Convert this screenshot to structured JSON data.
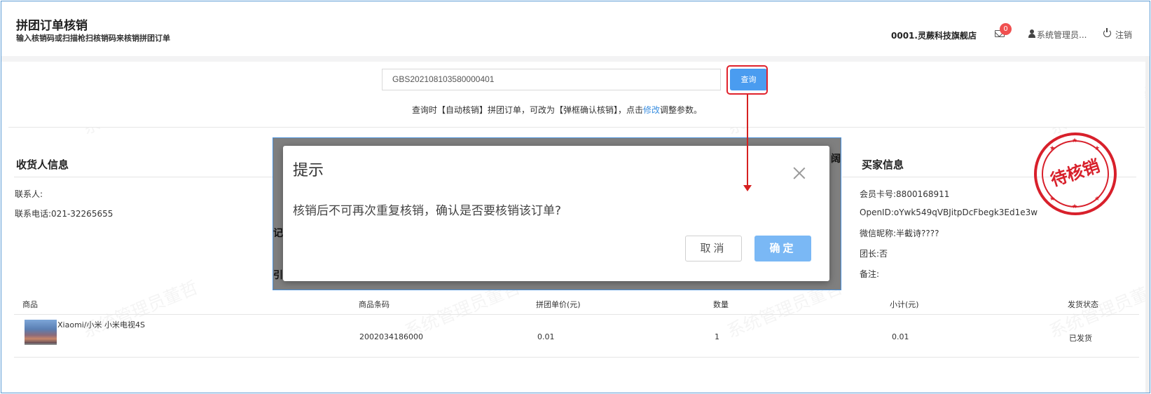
{
  "header": {
    "title": "拼团订单核销",
    "subtitle": "输入核销码或扫描枪扫核销码来核销拼团订单",
    "store": "0001.灵蕨科技旗舰店",
    "mail_count": "0",
    "user": "系统管理员...",
    "logout": "注销"
  },
  "search": {
    "value": "GBS202108103580000401",
    "button": "查询",
    "hint_pre": "查询时【自动核销】拼团订单，可改为【弹框确认核销】，点击",
    "hint_link": "修改",
    "hint_post": "调整参数。"
  },
  "receiver": {
    "title": "收货人信息",
    "contact_label": "联系人:",
    "phone_label": "联系电话:021-32265655"
  },
  "buyer": {
    "title": "买家信息",
    "member_card": "会员卡号:8800168911",
    "openid": "OpenID:oYwk549qVBJitpDcFbegk3Ed1e3w",
    "nickname": "微信昵称:半截诗????",
    "leader": "团长:否",
    "remark": "备注:"
  },
  "stamp": {
    "text": "待核销"
  },
  "table": {
    "headers": [
      "商品",
      "商品条码",
      "拼团单价(元)",
      "数量",
      "小计(元)",
      "发货状态"
    ],
    "rows": [
      {
        "product": "Xiaomi/小米 小米电视4S",
        "barcode": "2002034186000",
        "price": "0.01",
        "qty": "1",
        "subtotal": "0.01",
        "status": "已发货"
      }
    ]
  },
  "dialog": {
    "title": "提示",
    "message": "核销后不可再次重复核销，确认是否要核销该订单?",
    "cancel": "取消",
    "ok": "确定"
  },
  "partial": {
    "behind_right": "阔",
    "behind_left_1": "记",
    "behind_left_2": "引"
  },
  "watermark": "系统管理员董哲",
  "colors": {
    "primary": "#4a9cf0",
    "highlight": "#e0222c",
    "stamp": "#d8202b",
    "badge": "#f05050"
  },
  "icons": [
    "mail-icon",
    "user-icon",
    "power-icon",
    "close-icon"
  ]
}
